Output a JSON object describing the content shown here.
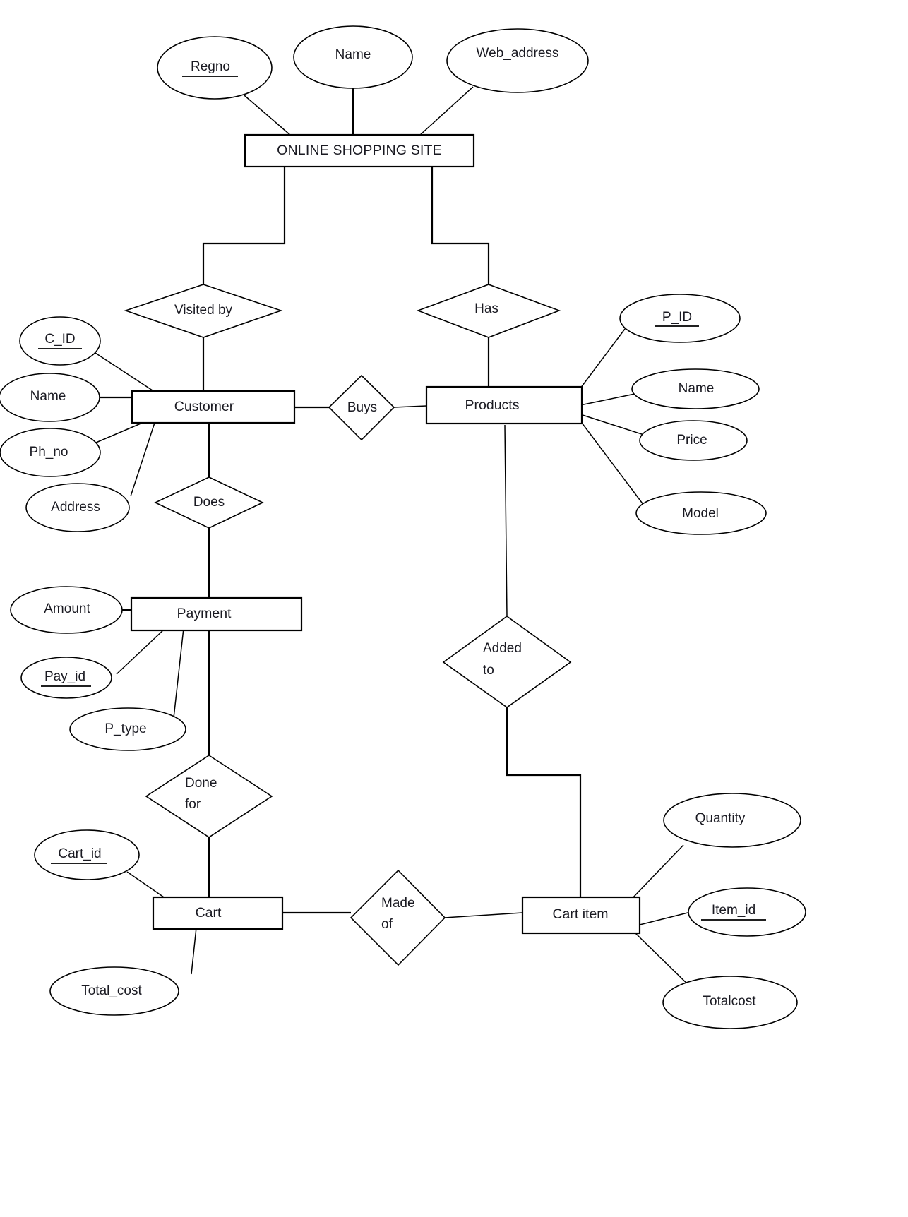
{
  "diagram": {
    "title_entity": "ONLINE SHOPPING SITE",
    "type": "entity-relationship-diagram",
    "colors": {
      "stroke": "#000000",
      "fill": "#ffffff",
      "text": "#1a1a22"
    }
  },
  "entities": [
    {
      "id": "site",
      "label": "ONLINE SHOPPING SITE"
    },
    {
      "id": "customer",
      "label": "Customer"
    },
    {
      "id": "products",
      "label": "Products"
    },
    {
      "id": "payment",
      "label": "Payment"
    },
    {
      "id": "cart",
      "label": "Cart"
    },
    {
      "id": "cart_item",
      "label": "Cart item"
    }
  ],
  "relationships": [
    {
      "id": "visited_by",
      "label": "Visited by",
      "line1": "Visited by",
      "line2": ""
    },
    {
      "id": "has",
      "label": "Has",
      "line1": "Has",
      "line2": ""
    },
    {
      "id": "buys",
      "label": "Buys",
      "line1": "Buys",
      "line2": ""
    },
    {
      "id": "does",
      "label": "Does",
      "line1": "Does",
      "line2": ""
    },
    {
      "id": "added_to",
      "label": "Added to",
      "line1": "Added",
      "line2": "to"
    },
    {
      "id": "done_for",
      "label": "Done for",
      "line1": "Done",
      "line2": "for"
    },
    {
      "id": "made_of",
      "label": "Made of",
      "line1": "Made",
      "line2": "of"
    }
  ],
  "attributes": [
    {
      "id": "site_regno",
      "label": "Regno",
      "owner": "site",
      "key": true
    },
    {
      "id": "site_name",
      "label": "Name",
      "owner": "site",
      "key": false
    },
    {
      "id": "site_web",
      "label": "Web_address",
      "owner": "site",
      "key": false
    },
    {
      "id": "cust_cid",
      "label": "C_ID",
      "owner": "customer",
      "key": true
    },
    {
      "id": "cust_name",
      "label": "Name",
      "owner": "customer",
      "key": false
    },
    {
      "id": "cust_phno",
      "label": "Ph_no",
      "owner": "customer",
      "key": false
    },
    {
      "id": "cust_address",
      "label": "Address",
      "owner": "customer",
      "key": false
    },
    {
      "id": "prod_pid",
      "label": "P_ID",
      "owner": "products",
      "key": true
    },
    {
      "id": "prod_name",
      "label": "Name",
      "owner": "products",
      "key": false
    },
    {
      "id": "prod_price",
      "label": "Price",
      "owner": "products",
      "key": false
    },
    {
      "id": "prod_model",
      "label": "Model",
      "owner": "products",
      "key": false
    },
    {
      "id": "pay_amount",
      "label": "Amount",
      "owner": "payment",
      "key": false
    },
    {
      "id": "pay_payid",
      "label": "Pay_id",
      "owner": "payment",
      "key": true
    },
    {
      "id": "pay_ptype",
      "label": "P_type",
      "owner": "payment",
      "key": false
    },
    {
      "id": "cart_cartid",
      "label": "Cart_id",
      "owner": "cart",
      "key": true
    },
    {
      "id": "cart_totalcost",
      "label": "Total_cost",
      "owner": "cart",
      "key": false
    },
    {
      "id": "ci_quantity",
      "label": "Quantity",
      "owner": "cart_item",
      "key": false
    },
    {
      "id": "ci_itemid",
      "label": "Item_id",
      "owner": "cart_item",
      "key": true
    },
    {
      "id": "ci_totalcost",
      "label": "Totalcost",
      "owner": "cart_item",
      "key": false
    }
  ]
}
